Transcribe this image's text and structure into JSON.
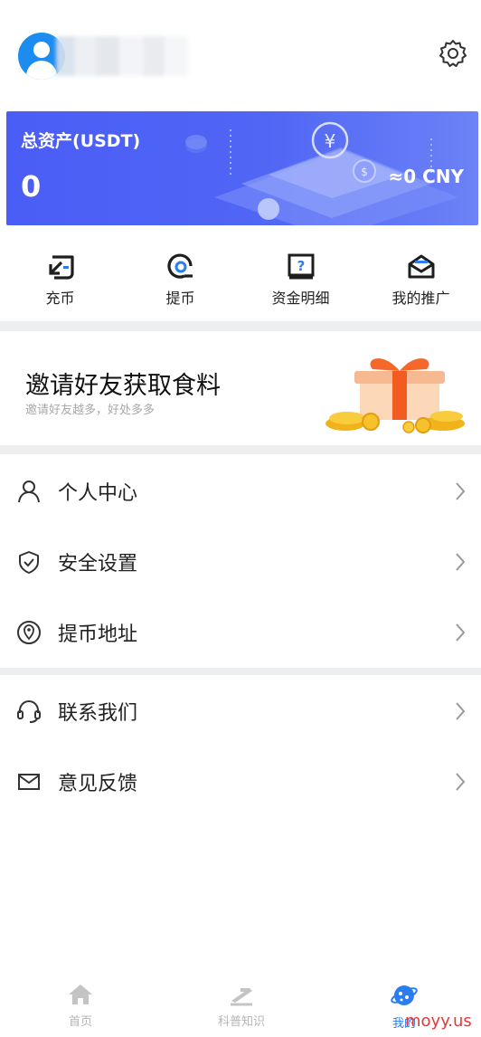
{
  "header": {
    "avatar_icon": "user-avatar-icon",
    "settings_icon": "gear-icon"
  },
  "asset_card": {
    "label": "总资产(USDT)",
    "value": "0",
    "cny_value": "≈0 CNY",
    "colors": {
      "background": "#4a5df6"
    }
  },
  "actions": [
    {
      "label": "充币",
      "icon": "deposit-icon"
    },
    {
      "label": "提币",
      "icon": "withdraw-icon"
    },
    {
      "label": "资金明细",
      "icon": "fund-details-icon"
    },
    {
      "label": "我的推广",
      "icon": "promotion-icon"
    }
  ],
  "banner": {
    "title": "邀请好友获取食料",
    "subtitle": "邀请好友越多，好处多多",
    "art": "gift-coins-illustration"
  },
  "menu_group_1": [
    {
      "label": "个人中心",
      "icon": "person-icon"
    },
    {
      "label": "安全设置",
      "icon": "shield-icon"
    },
    {
      "label": "提币地址",
      "icon": "location-pin-icon"
    }
  ],
  "menu_group_2": [
    {
      "label": "联系我们",
      "icon": "headset-icon"
    },
    {
      "label": "意见反馈",
      "icon": "envelope-icon"
    }
  ],
  "bottom_nav": [
    {
      "label": "首页",
      "icon": "home-icon",
      "active": false
    },
    {
      "label": "科普知识",
      "icon": "knowledge-icon",
      "active": false
    },
    {
      "label": "我的",
      "icon": "profile-planet-icon",
      "active": true
    }
  ],
  "watermark": "moyy.us",
  "colors": {
    "accent": "#2a7df1",
    "card": "#4a5df6",
    "divider": "#eceef0"
  }
}
